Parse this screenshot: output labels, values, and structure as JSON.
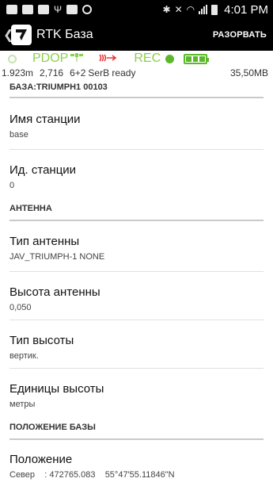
{
  "statusbar": {
    "time": "4:01 PM"
  },
  "actionbar": {
    "title": "RTK База",
    "action_label": "РАЗОРВАТЬ"
  },
  "status": {
    "pdop_label": "PDOP",
    "rec_label": "REC",
    "accuracy": "1.923m",
    "value2": "2,716",
    "sats": "6+2",
    "serial_state": "SerB ready",
    "memory": "35,50MB"
  },
  "sections": {
    "base": "БАЗА:TRIUMPH1 00103",
    "antenna": "АНТЕННА",
    "position": "ПОЛОЖЕНИЕ БАЗЫ"
  },
  "items": {
    "station_name": {
      "title": "Имя станции",
      "value": "base"
    },
    "station_id": {
      "title": "Ид. станции",
      "value": "0"
    },
    "antenna_type": {
      "title": "Тип антенны",
      "value": "JAV_TRIUMPH-1 NONE"
    },
    "antenna_height": {
      "title": "Высота антенны",
      "value": "0,050"
    },
    "height_type": {
      "title": "Тип высоты",
      "value": "вертик."
    },
    "height_units": {
      "title": "Единицы высоты",
      "value": "метры"
    },
    "position": {
      "title": "Положение",
      "value": "Север    : 472765.083    55°47'55.11846\"N"
    }
  },
  "colors": {
    "accent_green": "#8ccf4c",
    "radio_red": "#e33333",
    "bar_black": "#000000"
  },
  "icons": [
    "back-chevron-icon",
    "app-logo-icon",
    "satellite-icon",
    "radio-link-icon",
    "battery-icon"
  ]
}
